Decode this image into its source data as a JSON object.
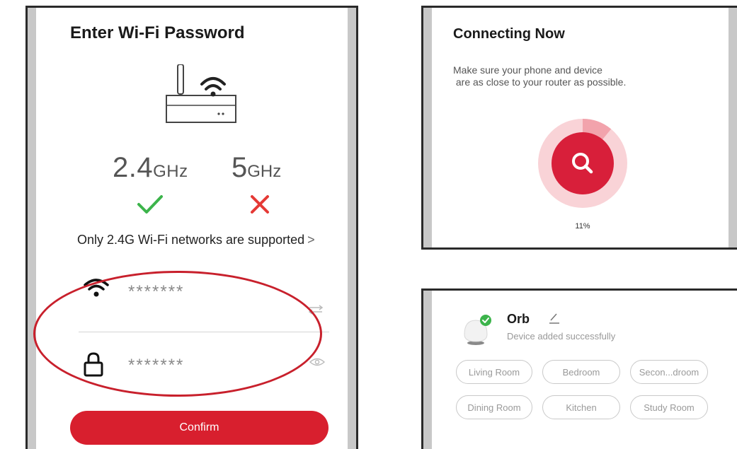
{
  "wifi_password_screen": {
    "title": "Enter Wi-Fi Password",
    "band_24_value": "2.4",
    "band_24_unit": "GHz",
    "band_5_value": "5",
    "band_5_unit": "GHz",
    "support_note": "Only 2.4G Wi-Fi networks are supported",
    "support_chevron": ">",
    "ssid_value": "*******",
    "password_value": "*******",
    "confirm_label": "Confirm",
    "colors": {
      "accent": "#d81f2e",
      "check": "#3cb44b",
      "cross": "#e53935"
    }
  },
  "connecting_screen": {
    "title": "Connecting Now",
    "hint": "Make sure your phone and device\n are as close to your router as possible.",
    "progress": 0.11,
    "progress_label": "11%"
  },
  "device_added_screen": {
    "device_name": "Orb",
    "status": "Device added successfully",
    "rooms": [
      "Living Room",
      "Bedroom",
      "Secon...droom",
      "Dining Room",
      "Kitchen",
      "Study Room"
    ]
  }
}
